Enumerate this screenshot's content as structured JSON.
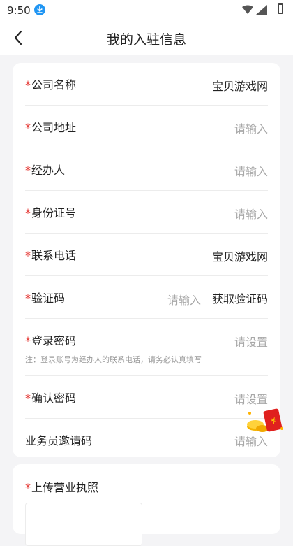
{
  "status_bar": {
    "time": "9:50"
  },
  "header": {
    "title": "我的入驻信息"
  },
  "form": {
    "required_mark": "*",
    "company_name": {
      "label": "公司名称",
      "value": "宝贝游戏网"
    },
    "company_address": {
      "label": "公司地址",
      "placeholder": "请输入"
    },
    "handler": {
      "label": "经办人",
      "placeholder": "请输入"
    },
    "id_number": {
      "label": "身份证号",
      "placeholder": "请输入"
    },
    "phone": {
      "label": "联系电话",
      "value": "宝贝游戏网"
    },
    "verify_code": {
      "label": "验证码",
      "placeholder": "请输入",
      "button": "获取验证码"
    },
    "login_password": {
      "label": "登录密码",
      "placeholder": "请设置",
      "note": "注：登录账号为经办人的联系电话，请务必认真填写"
    },
    "confirm_password": {
      "label": "确认密码",
      "placeholder": "请设置"
    },
    "referral_code": {
      "label": "业务员邀请码",
      "placeholder": "请输入"
    }
  },
  "upload": {
    "label": "上传营业执照"
  },
  "redpacket": {
    "symbol": "¥"
  },
  "colors": {
    "required": "#e53935",
    "placeholder": "#a8a8a8",
    "background": "#f4f4f6"
  }
}
